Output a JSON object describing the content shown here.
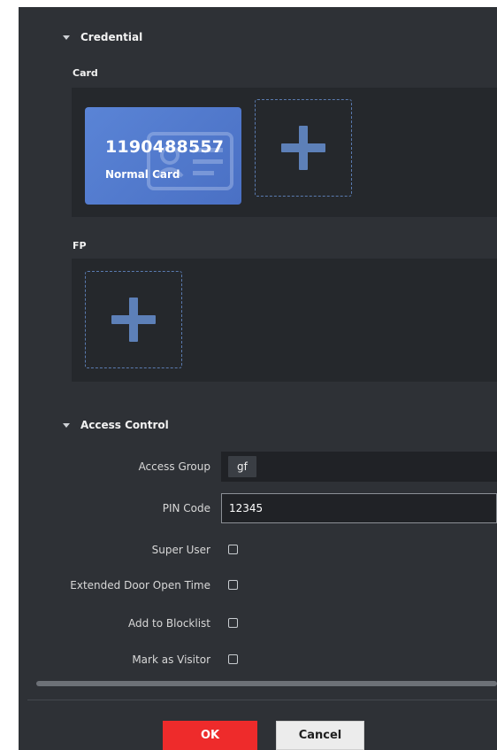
{
  "credential": {
    "section_title": "Credential",
    "card": {
      "label": "Card",
      "items": [
        {
          "number": "1190488557",
          "type": "Normal Card"
        }
      ]
    },
    "fp": {
      "label": "FP"
    }
  },
  "access_control": {
    "section_title": "Access Control",
    "access_group": {
      "label": "Access Group",
      "value": "gf"
    },
    "pin_code": {
      "label": "PIN Code",
      "value": "12345"
    },
    "super_user": {
      "label": "Super User",
      "checked": false
    },
    "extended_door_open_time": {
      "label": "Extended Door Open Time",
      "checked": false
    },
    "add_to_blocklist": {
      "label": "Add to Blocklist",
      "checked": false
    },
    "mark_as_visitor": {
      "label": "Mark as Visitor",
      "checked": false
    }
  },
  "footer": {
    "ok_label": "OK",
    "cancel_label": "Cancel"
  },
  "colors": {
    "panel_bg": "#2e3136",
    "card_accent": "#4a70c4",
    "ok_button": "#ee2b2b"
  }
}
